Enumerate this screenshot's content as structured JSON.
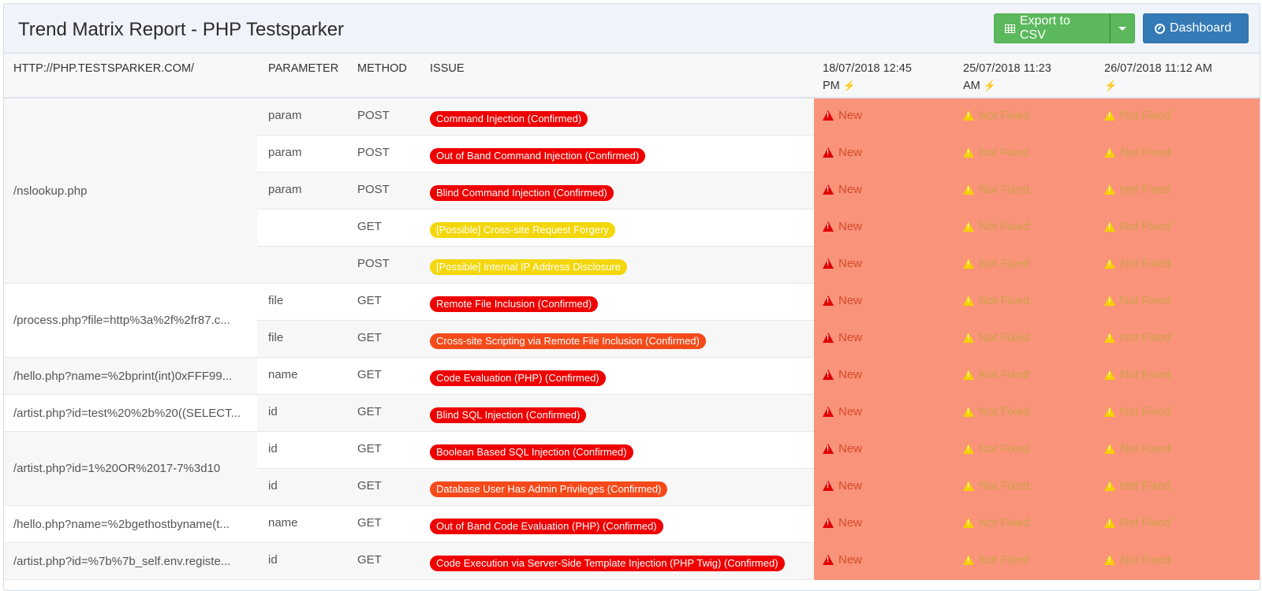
{
  "header": {
    "title": "Trend Matrix Report - PHP Testsparker",
    "export_label": "Export to CSV",
    "dashboard_label": "Dashboard"
  },
  "columns": {
    "url": "HTTP://PHP.TESTSPARKER.COM/",
    "parameter": "PARAMETER",
    "method": "METHOD",
    "issue": "ISSUE",
    "dates": [
      {
        "line1": "18/07/2018 12:45",
        "line2": "PM"
      },
      {
        "line1": "25/07/2018 11:23",
        "line2": "AM"
      },
      {
        "line1": "26/07/2018 11:12 AM",
        "line2": ""
      }
    ]
  },
  "status_labels": {
    "new": "New",
    "not_fixed": "Not Fixed"
  },
  "colors": {
    "red": "#ee0000",
    "orange": "#f44a1a",
    "yellow": "#f3d70b",
    "status_bg": "#f99379",
    "green_btn": "#5cb85c",
    "blue_btn": "#337ab7"
  },
  "groups": [
    {
      "url": "/nslookup.php",
      "rows": [
        {
          "param": "param",
          "method": "POST",
          "issue": "Command Injection (Confirmed)",
          "severity": "red"
        },
        {
          "param": "param",
          "method": "POST",
          "issue": "Out of Band Command Injection (Confirmed)",
          "severity": "red"
        },
        {
          "param": "param",
          "method": "POST",
          "issue": "Blind Command Injection (Confirmed)",
          "severity": "red"
        },
        {
          "param": "",
          "method": "GET",
          "issue": "[Possible] Cross-site Request Forgery",
          "severity": "yellow"
        },
        {
          "param": "",
          "method": "POST",
          "issue": "[Possible] Internal IP Address Disclosure",
          "severity": "yellow"
        }
      ]
    },
    {
      "url": "/process.php?file=http%3a%2f%2fr87.c...",
      "rows": [
        {
          "param": "file",
          "method": "GET",
          "issue": "Remote File Inclusion (Confirmed)",
          "severity": "red"
        },
        {
          "param": "file",
          "method": "GET",
          "issue": "Cross-site Scripting via Remote File Inclusion (Confirmed)",
          "severity": "orange"
        }
      ]
    },
    {
      "url": "/hello.php?name=%2bprint(int)0xFFF99...",
      "rows": [
        {
          "param": "name",
          "method": "GET",
          "issue": "Code Evaluation (PHP) (Confirmed)",
          "severity": "red"
        }
      ]
    },
    {
      "url": "/artist.php?id=test%20%2b%20((SELECT...",
      "rows": [
        {
          "param": "id",
          "method": "GET",
          "issue": "Blind SQL Injection (Confirmed)",
          "severity": "red"
        }
      ]
    },
    {
      "url": "/artist.php?id=1%20OR%2017-7%3d10",
      "rows": [
        {
          "param": "id",
          "method": "GET",
          "issue": "Boolean Based SQL Injection (Confirmed)",
          "severity": "red"
        },
        {
          "param": "id",
          "method": "GET",
          "issue": "Database User Has Admin Privileges (Confirmed)",
          "severity": "orange"
        }
      ]
    },
    {
      "url": "/hello.php?name=%2bgethostbyname(t...",
      "rows": [
        {
          "param": "name",
          "method": "GET",
          "issue": "Out of Band Code Evaluation (PHP) (Confirmed)",
          "severity": "red"
        }
      ]
    },
    {
      "url": "/artist.php?id=%7b%7b_self.env.registe...",
      "rows": [
        {
          "param": "id",
          "method": "GET",
          "issue": "Code Execution via Server-Side Template Injection (PHP Twig) (Confirmed)",
          "severity": "red"
        }
      ]
    }
  ]
}
